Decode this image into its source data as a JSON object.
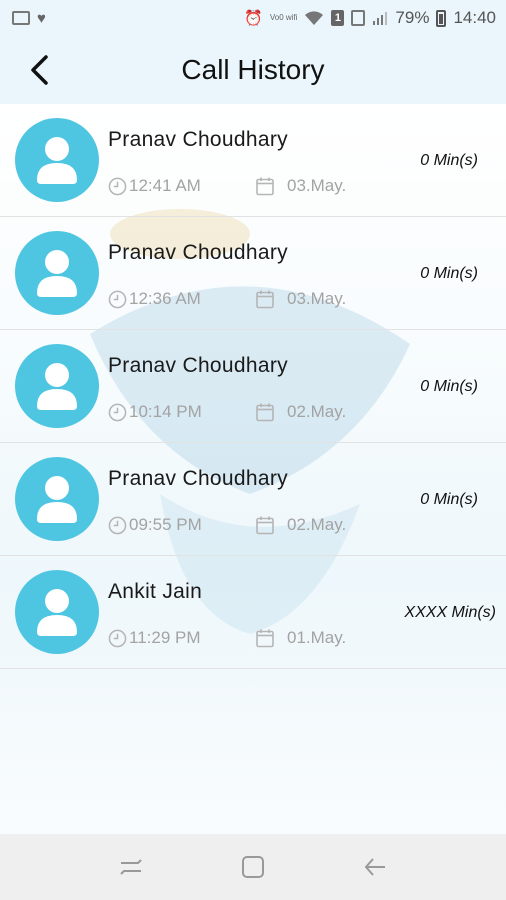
{
  "status_bar": {
    "battery": "79%",
    "time": "14:40",
    "sim": "1",
    "volte": "Vo0 wifi"
  },
  "header": {
    "title": "Call History"
  },
  "calls": [
    {
      "name": "Pranav Choudhary",
      "time": "12:41 AM",
      "date": "03.May.",
      "duration": "0 Min(s)"
    },
    {
      "name": "Pranav Choudhary",
      "time": "12:36 AM",
      "date": "03.May.",
      "duration": "0 Min(s)"
    },
    {
      "name": "Pranav Choudhary",
      "time": "10:14 PM",
      "date": "02.May.",
      "duration": "0 Min(s)"
    },
    {
      "name": "Pranav Choudhary",
      "time": "09:55 PM",
      "date": "02.May.",
      "duration": "0 Min(s)"
    },
    {
      "name": "Ankit Jain",
      "time": "11:29 PM",
      "date": "01.May.",
      "duration": "XXXX Min(s)"
    }
  ],
  "icons": {
    "back": "back-arrow-icon",
    "avatar": "user-avatar-icon",
    "clock": "clock-icon",
    "calendar": "calendar-icon",
    "recent": "recent-apps-icon",
    "home": "home-icon",
    "nav_back": "nav-back-icon"
  },
  "colors": {
    "header_bg": "#eaf6fb",
    "avatar_bg": "#4fc6e1",
    "meta_text": "#a3a3a3",
    "divider": "#e2e2e2"
  }
}
